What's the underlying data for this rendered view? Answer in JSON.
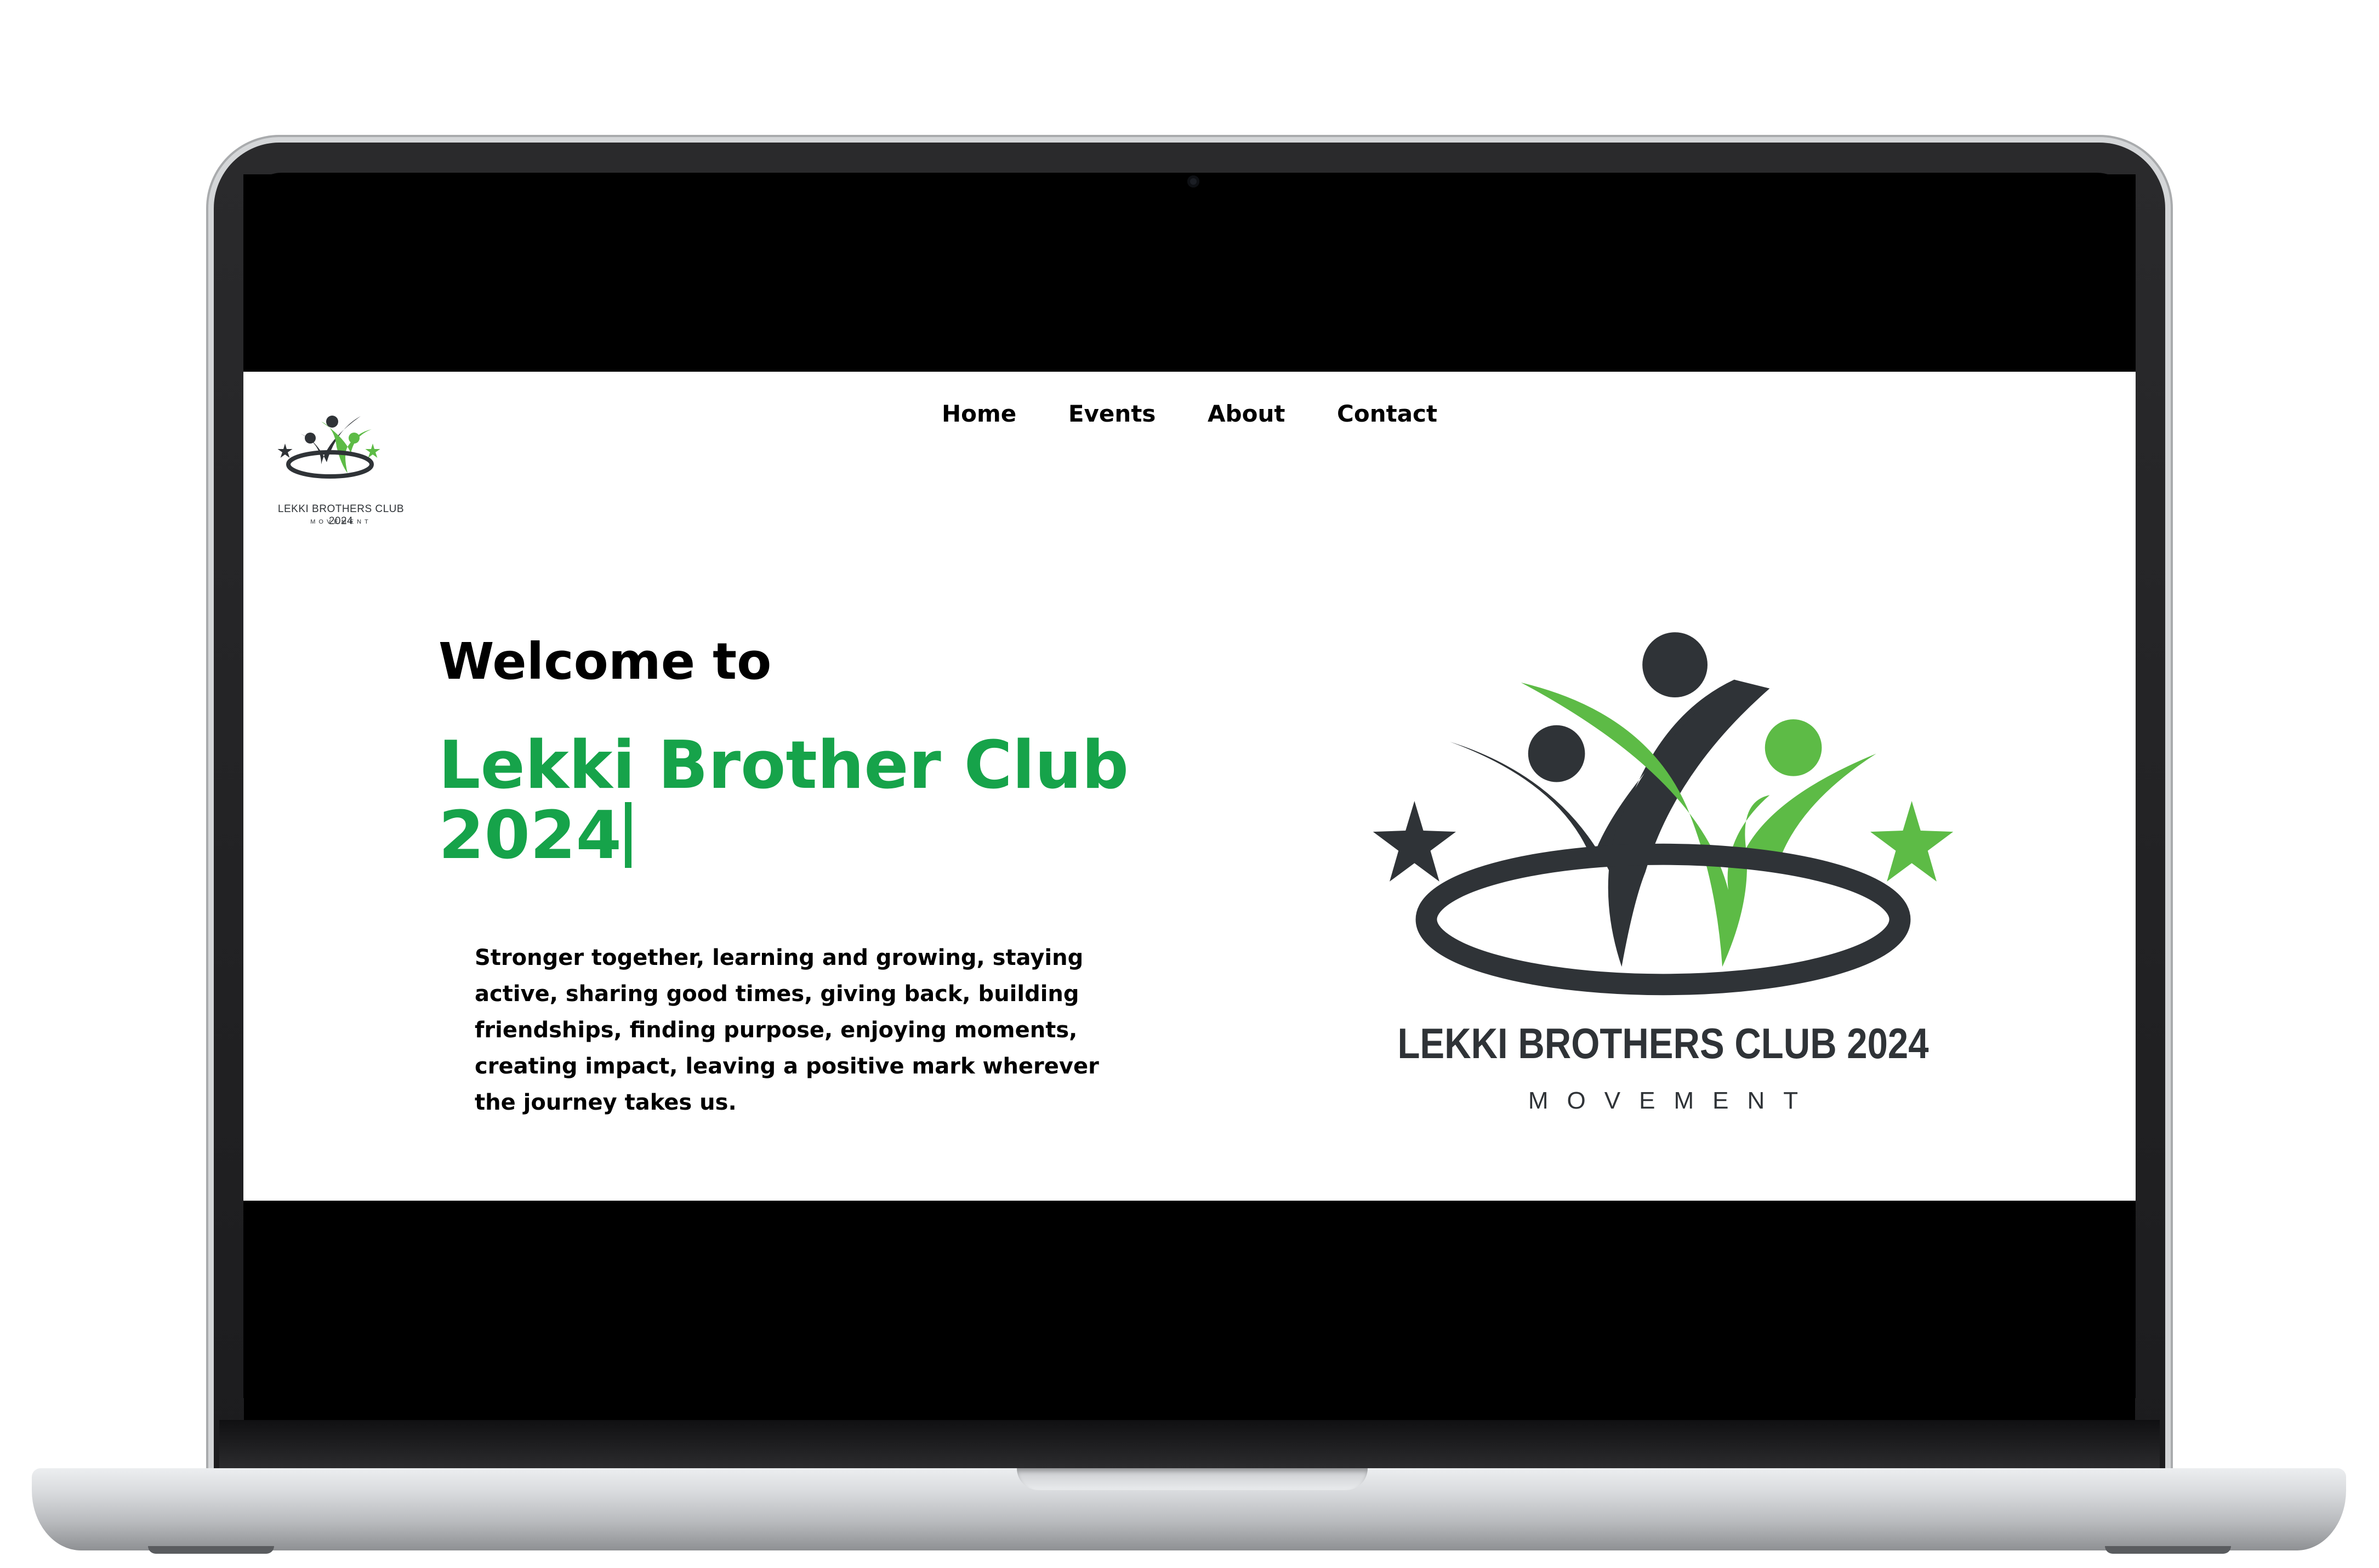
{
  "colors": {
    "brand_green": "#16a34a",
    "logo_green": "#5dbb46",
    "logo_dark": "#2f3337",
    "text": "#000000",
    "page_bg": "#ffffff"
  },
  "nav": {
    "items": [
      {
        "label": "Home"
      },
      {
        "label": "Events"
      },
      {
        "label": "About"
      },
      {
        "label": "Contact"
      }
    ]
  },
  "header_logo": {
    "icon": "club-logo-icon",
    "text": "LEKKI BROTHERS CLUB 2024",
    "subtext": "MOVEMENT"
  },
  "hero": {
    "welcome": "Welcome to",
    "title_line1": "Lekki Brother Club",
    "title_line2": "2024",
    "tagline": "Stronger together, learning and growing, staying active, sharing good times, giving back, building friendships, finding purpose, enjoying moments, creating impact, leaving a positive mark wherever the journey takes us."
  },
  "hero_logo": {
    "icon": "club-logo-icon",
    "text": "LEKKI BROTHERS CLUB 2024",
    "subtext": "MOVEMENT"
  }
}
